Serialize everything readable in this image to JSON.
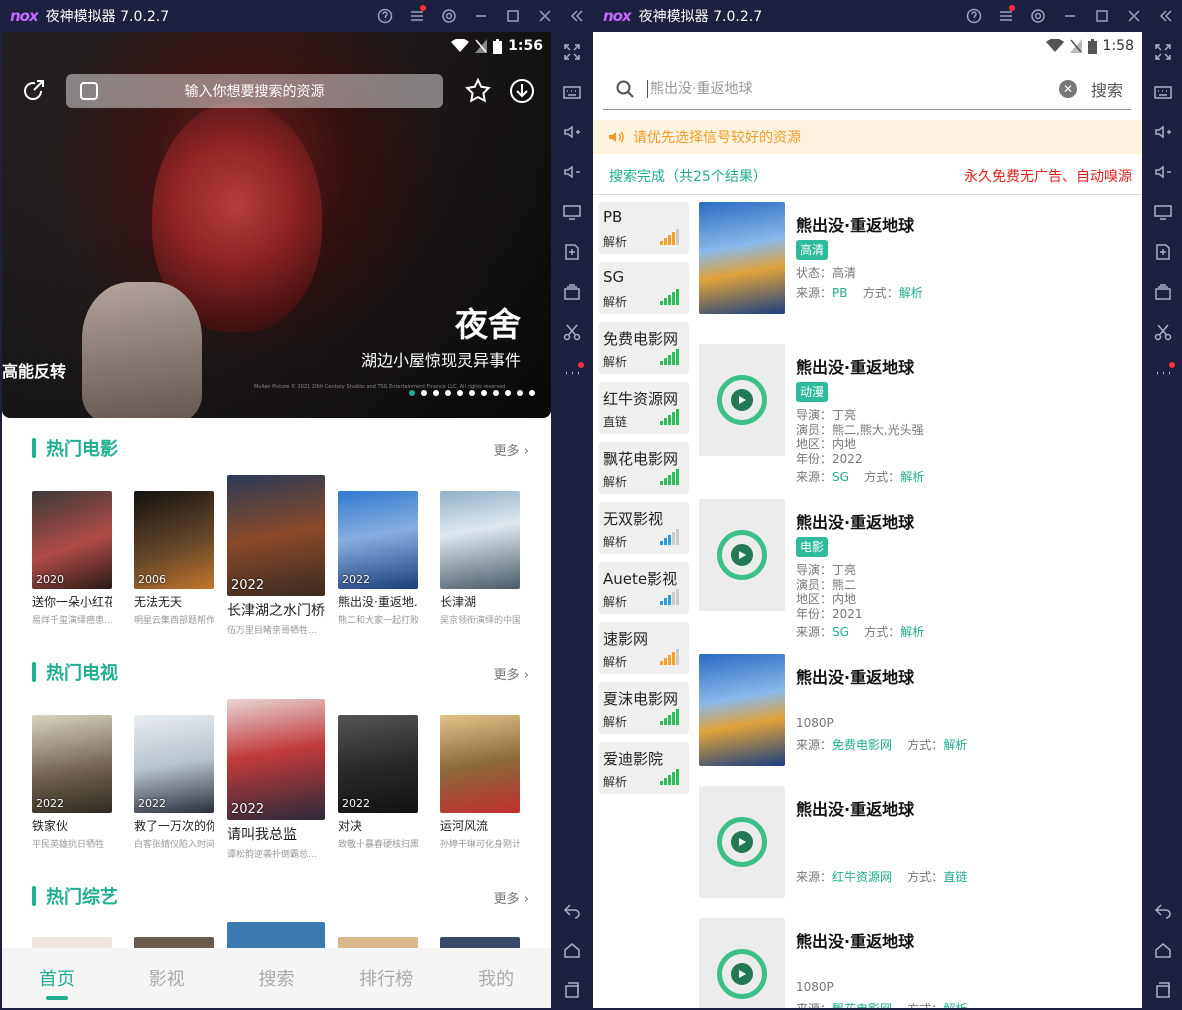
{
  "left_window": {
    "logo": "nox",
    "title": "夜神模拟器 7.0.2.7",
    "status_time": "1:56",
    "search_placeholder": "输入你想要搜索的资源",
    "banner": {
      "title": "夜舍",
      "subtitle": "湖边小屋惊现灵异事件",
      "left_text": "高能反转",
      "copyright": "Mullan Picture © 2021 20th Century Studios and TSG Entertainment Finance LLC. All rights reserved."
    },
    "sections": [
      {
        "title": "热门电影",
        "more": "更多",
        "items": [
          {
            "name": "送你一朵小红花",
            "year": "2020",
            "desc": "易烊千玺演绎癌患..."
          },
          {
            "name": "无法无天",
            "year": "2006",
            "desc": "明星云集西部题帮作..."
          },
          {
            "name": "长津湖之水门桥",
            "year": "2022",
            "desc": "伍万里目睹亲哥牺牲..."
          },
          {
            "name": "熊出没·重返地...",
            "year": "2022",
            "desc": "熊二和大家一起打败..."
          },
          {
            "name": "长津湖",
            "year": "",
            "desc": "吴京领衔演绎的中国..."
          }
        ]
      },
      {
        "title": "热门电视",
        "more": "更多",
        "items": [
          {
            "name": "铁家伙",
            "year": "2022",
            "desc": "平民英雄抗日牺牲"
          },
          {
            "name": "救了一万次的你",
            "year": "2022",
            "desc": "白客张婧仪陷入时间..."
          },
          {
            "name": "请叫我总监",
            "year": "2022",
            "desc": "谭松韵逆袭扑倒霸总..."
          },
          {
            "name": "对决",
            "year": "2022",
            "desc": "致敬十暴春硬核扫黑"
          },
          {
            "name": "运河风流",
            "year": "",
            "desc": "孙婷干琳可化身刚计..."
          }
        ]
      },
      {
        "title": "热门综艺",
        "more": "更多",
        "items": []
      }
    ],
    "tabs": [
      "首页",
      "影视",
      "搜索",
      "排行榜",
      "我的"
    ]
  },
  "right_window": {
    "logo": "nox",
    "title": "夜神模拟器 7.0.2.7",
    "status_time": "1:58",
    "search_value": "熊出没·重返地球",
    "search_button": "搜索",
    "notice": "请优先选择信号较好的资源",
    "status": "搜索完成（共25个结果）",
    "promo": "永久免费无广告、自动嗅源",
    "sources": [
      {
        "name": "PB",
        "mode": "解析",
        "level": 4,
        "color": "#f2a226"
      },
      {
        "name": "SG",
        "mode": "解析",
        "level": 5,
        "color": "#2fbf5a"
      },
      {
        "name": "免费电影网",
        "mode": "解析",
        "level": 5,
        "color": "#2fbf5a"
      },
      {
        "name": "红牛资源网",
        "mode": "直链",
        "level": 5,
        "color": "#2fbf5a"
      },
      {
        "name": "飘花电影网",
        "mode": "解析",
        "level": 5,
        "color": "#2fbf5a"
      },
      {
        "name": "无双影视",
        "mode": "解析",
        "level": 3,
        "color": "#2a9fd6"
      },
      {
        "name": "Auete影视",
        "mode": "解析",
        "level": 3,
        "color": "#2a9fd6"
      },
      {
        "name": "速影网",
        "mode": "解析",
        "level": 4,
        "color": "#f2a226"
      },
      {
        "name": "夏沫电影网",
        "mode": "解析",
        "level": 5,
        "color": "#2fbf5a"
      },
      {
        "name": "爱迪影院",
        "mode": "解析",
        "level": 5,
        "color": "#2fbf5a"
      }
    ],
    "results": [
      {
        "title": "熊出没·重返地球",
        "tag": "高清",
        "lines": [
          "状态：高清"
        ],
        "source": "PB",
        "mode": "解析",
        "poster": "image"
      },
      {
        "title": "熊出没·重返地球",
        "tag": "动漫",
        "lines": [
          "导演：丁亮",
          "演员：熊二,熊大,光头强",
          "地区：内地",
          "年份：2022"
        ],
        "source": "SG",
        "mode": "解析",
        "poster": "placeholder"
      },
      {
        "title": "熊出没·重返地球",
        "tag": "电影",
        "lines": [
          "导演：丁亮",
          "演员：熊二",
          "地区：内地",
          "年份：2021"
        ],
        "source": "SG",
        "mode": "解析",
        "poster": "placeholder"
      },
      {
        "title": "熊出没·重返地球",
        "tag": "",
        "lines": [
          "1080P"
        ],
        "source": "免费电影网",
        "mode": "解析",
        "poster": "image"
      },
      {
        "title": "熊出没·重返地球",
        "tag": "",
        "lines": [],
        "source": "红牛资源网",
        "mode": "直链",
        "poster": "placeholder"
      },
      {
        "title": "熊出没·重返地球",
        "tag": "",
        "lines": [
          "1080P"
        ],
        "source": "飘花电影网",
        "mode": "解析",
        "poster": "placeholder"
      }
    ],
    "labels": {
      "source": "来源：",
      "mode": "方式："
    }
  }
}
